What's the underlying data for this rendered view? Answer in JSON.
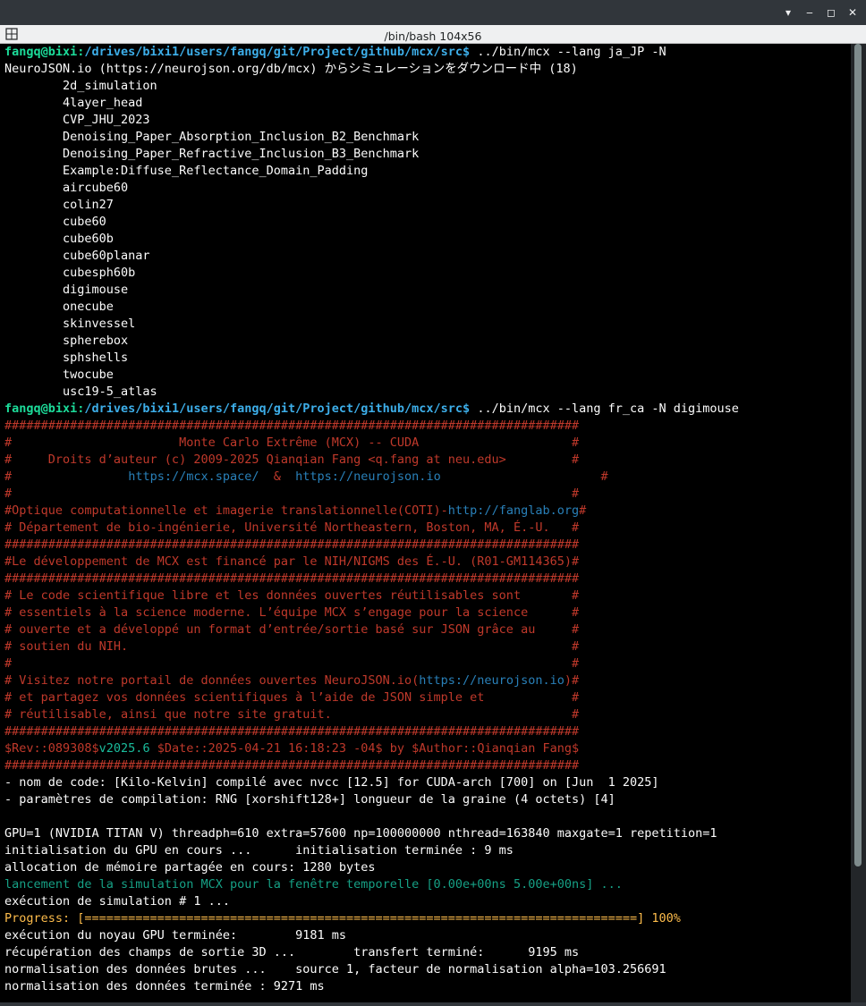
{
  "window": {
    "title": "/bin/bash 104x56",
    "buttons": {
      "minimize": "▾",
      "restore": "‒",
      "maximize": "◻",
      "close": "✕"
    }
  },
  "colors": {
    "text": "#fcfcfc",
    "prompt_user": "#1cdc9a",
    "prompt_path": "#3daee9",
    "banner": "#c0392b",
    "banner_link": "#2980b9",
    "revision": "#1abc9c",
    "progress": "#fdbc4b",
    "info": "#16a085"
  },
  "lines": [
    [
      {
        "t": "fangq@bixi:",
        "c": "#1cdc9a",
        "b": true
      },
      {
        "t": "/drives/bixi1/users/fangq/git/Project/github/mcx/src$",
        "c": "#3daee9",
        "b": true
      },
      {
        "t": " ../bin/mcx --lang ja_JP -N"
      }
    ],
    [
      {
        "t": "NeuroJSON.io (https://neurojson.org/db/mcx) からシミュレーションをダウンロード中 (18)"
      }
    ],
    [
      {
        "t": "        2d_simulation"
      }
    ],
    [
      {
        "t": "        4layer_head"
      }
    ],
    [
      {
        "t": "        CVP_JHU_2023"
      }
    ],
    [
      {
        "t": "        Denoising_Paper_Absorption_Inclusion_B2_Benchmark"
      }
    ],
    [
      {
        "t": "        Denoising_Paper_Refractive_Inclusion_B3_Benchmark"
      }
    ],
    [
      {
        "t": "        Example:Diffuse_Reflectance_Domain_Padding"
      }
    ],
    [
      {
        "t": "        aircube60"
      }
    ],
    [
      {
        "t": "        colin27"
      }
    ],
    [
      {
        "t": "        cube60"
      }
    ],
    [
      {
        "t": "        cube60b"
      }
    ],
    [
      {
        "t": "        cube60planar"
      }
    ],
    [
      {
        "t": "        cubesph60b"
      }
    ],
    [
      {
        "t": "        digimouse"
      }
    ],
    [
      {
        "t": "        onecube"
      }
    ],
    [
      {
        "t": "        skinvessel"
      }
    ],
    [
      {
        "t": "        spherebox"
      }
    ],
    [
      {
        "t": "        sphshells"
      }
    ],
    [
      {
        "t": "        twocube"
      }
    ],
    [
      {
        "t": "        usc19-5_atlas"
      }
    ],
    [
      {
        "t": "fangq@bixi:",
        "c": "#1cdc9a",
        "b": true
      },
      {
        "t": "/drives/bixi1/users/fangq/git/Project/github/mcx/src$",
        "c": "#3daee9",
        "b": true
      },
      {
        "t": " ../bin/mcx --lang fr_ca -N digimouse"
      }
    ],
    [
      {
        "t": "###############################################################################",
        "c": "#c0392b"
      }
    ],
    [
      {
        "t": "#                       Monte Carlo Extrême (MCX) -- CUDA                     #",
        "c": "#c0392b"
      }
    ],
    [
      {
        "t": "#     Droits d’auteur (c) 2009-2025 Qianqian Fang <q.fang at neu.edu>         #",
        "c": "#c0392b"
      }
    ],
    [
      {
        "t": "#",
        "c": "#c0392b"
      },
      {
        "t": "                ",
        "c": "#c0392b"
      },
      {
        "t": "https://mcx.space/",
        "c": "#2980b9"
      },
      {
        "t": "  &  ",
        "c": "#c0392b"
      },
      {
        "t": "https://neurojson.io",
        "c": "#2980b9"
      },
      {
        "t": "                      #",
        "c": "#c0392b"
      }
    ],
    [
      {
        "t": "#                                                                             #",
        "c": "#c0392b"
      }
    ],
    [
      {
        "t": "#Optique computationnelle et imagerie translationnelle(COTI)-",
        "c": "#c0392b"
      },
      {
        "t": "http://fanglab.org",
        "c": "#2980b9"
      },
      {
        "t": "#",
        "c": "#c0392b"
      }
    ],
    [
      {
        "t": "# Département de bio-ingénierie, Université Northeastern, Boston, MA, É.-U.   #",
        "c": "#c0392b"
      }
    ],
    [
      {
        "t": "###############################################################################",
        "c": "#c0392b"
      }
    ],
    [
      {
        "t": "#Le développement de MCX est financé par le NIH/NIGMS des É.-U. (R01-GM114365)#",
        "c": "#c0392b"
      }
    ],
    [
      {
        "t": "###############################################################################",
        "c": "#c0392b"
      }
    ],
    [
      {
        "t": "# Le code scientifique libre et les données ouvertes réutilisables sont       #",
        "c": "#c0392b"
      }
    ],
    [
      {
        "t": "# essentiels à la science moderne. L’équipe MCX s’engage pour la science      #",
        "c": "#c0392b"
      }
    ],
    [
      {
        "t": "# ouverte et a développé un format d’entrée/sortie basé sur JSON grâce au     #",
        "c": "#c0392b"
      }
    ],
    [
      {
        "t": "# soutien du NIH.                                                             #",
        "c": "#c0392b"
      }
    ],
    [
      {
        "t": "#                                                                             #",
        "c": "#c0392b"
      }
    ],
    [
      {
        "t": "# Visitez notre portail de données ouvertes NeuroJSON.io(",
        "c": "#c0392b"
      },
      {
        "t": "https://neurojson.io",
        "c": "#2980b9"
      },
      {
        "t": ")#",
        "c": "#c0392b"
      }
    ],
    [
      {
        "t": "# et partagez vos données scientifiques à l’aide de JSON simple et            #",
        "c": "#c0392b"
      }
    ],
    [
      {
        "t": "# réutilisable, ainsi que notre site gratuit.                                 #",
        "c": "#c0392b"
      }
    ],
    [
      {
        "t": "###############################################################################",
        "c": "#c0392b"
      }
    ],
    [
      {
        "t": "$Rev::089308$",
        "c": "#c0392b"
      },
      {
        "t": "v2025.6",
        "c": "#1abc9c"
      },
      {
        "t": " $Date::2025-04-21 16:18:23 -04$ by $Author::Qianqian Fang$",
        "c": "#c0392b"
      }
    ],
    [
      {
        "t": "###############################################################################",
        "c": "#c0392b"
      }
    ],
    [
      {
        "t": "- nom de code: [Kilo-Kelvin] compilé avec nvcc [12.5] for CUDA-arch [700] on [Jun  1 2025]"
      }
    ],
    [
      {
        "t": "- paramètres de compilation: RNG [xorshift128+] longueur de la graine (4 octets) [4]"
      }
    ],
    [
      {
        "t": ""
      }
    ],
    [
      {
        "t": "GPU=1 (NVIDIA TITAN V) threadph=610 extra=57600 np=100000000 nthread=163840 maxgate=1 repetition=1"
      }
    ],
    [
      {
        "t": "initialisation du GPU en cours ...      initialisation terminée : 9 ms"
      }
    ],
    [
      {
        "t": "allocation de mémoire partagée en cours: 1280 bytes"
      }
    ],
    [
      {
        "t": "lancement de la simulation MCX pour la fenêtre temporelle [0.00e+00ns 5.00e+00ns] ...",
        "c": "#16a085"
      }
    ],
    [
      {
        "t": "exécution de simulation # 1 ..."
      }
    ],
    [
      {
        "t": "Progress: [============================================================================] 100%",
        "c": "#fdbc4b"
      }
    ],
    [
      {
        "t": "exécution du noyau GPU terminée:        9181 ms"
      }
    ],
    [
      {
        "t": "récupération des champs de sortie 3D ...        transfert terminé:      9195 ms"
      }
    ],
    [
      {
        "t": "normalisation des données brutes ...    source 1, facteur de normalisation alpha=103.256691"
      }
    ],
    [
      {
        "t": "normalisation des données terminée : 9271 ms"
      }
    ]
  ]
}
